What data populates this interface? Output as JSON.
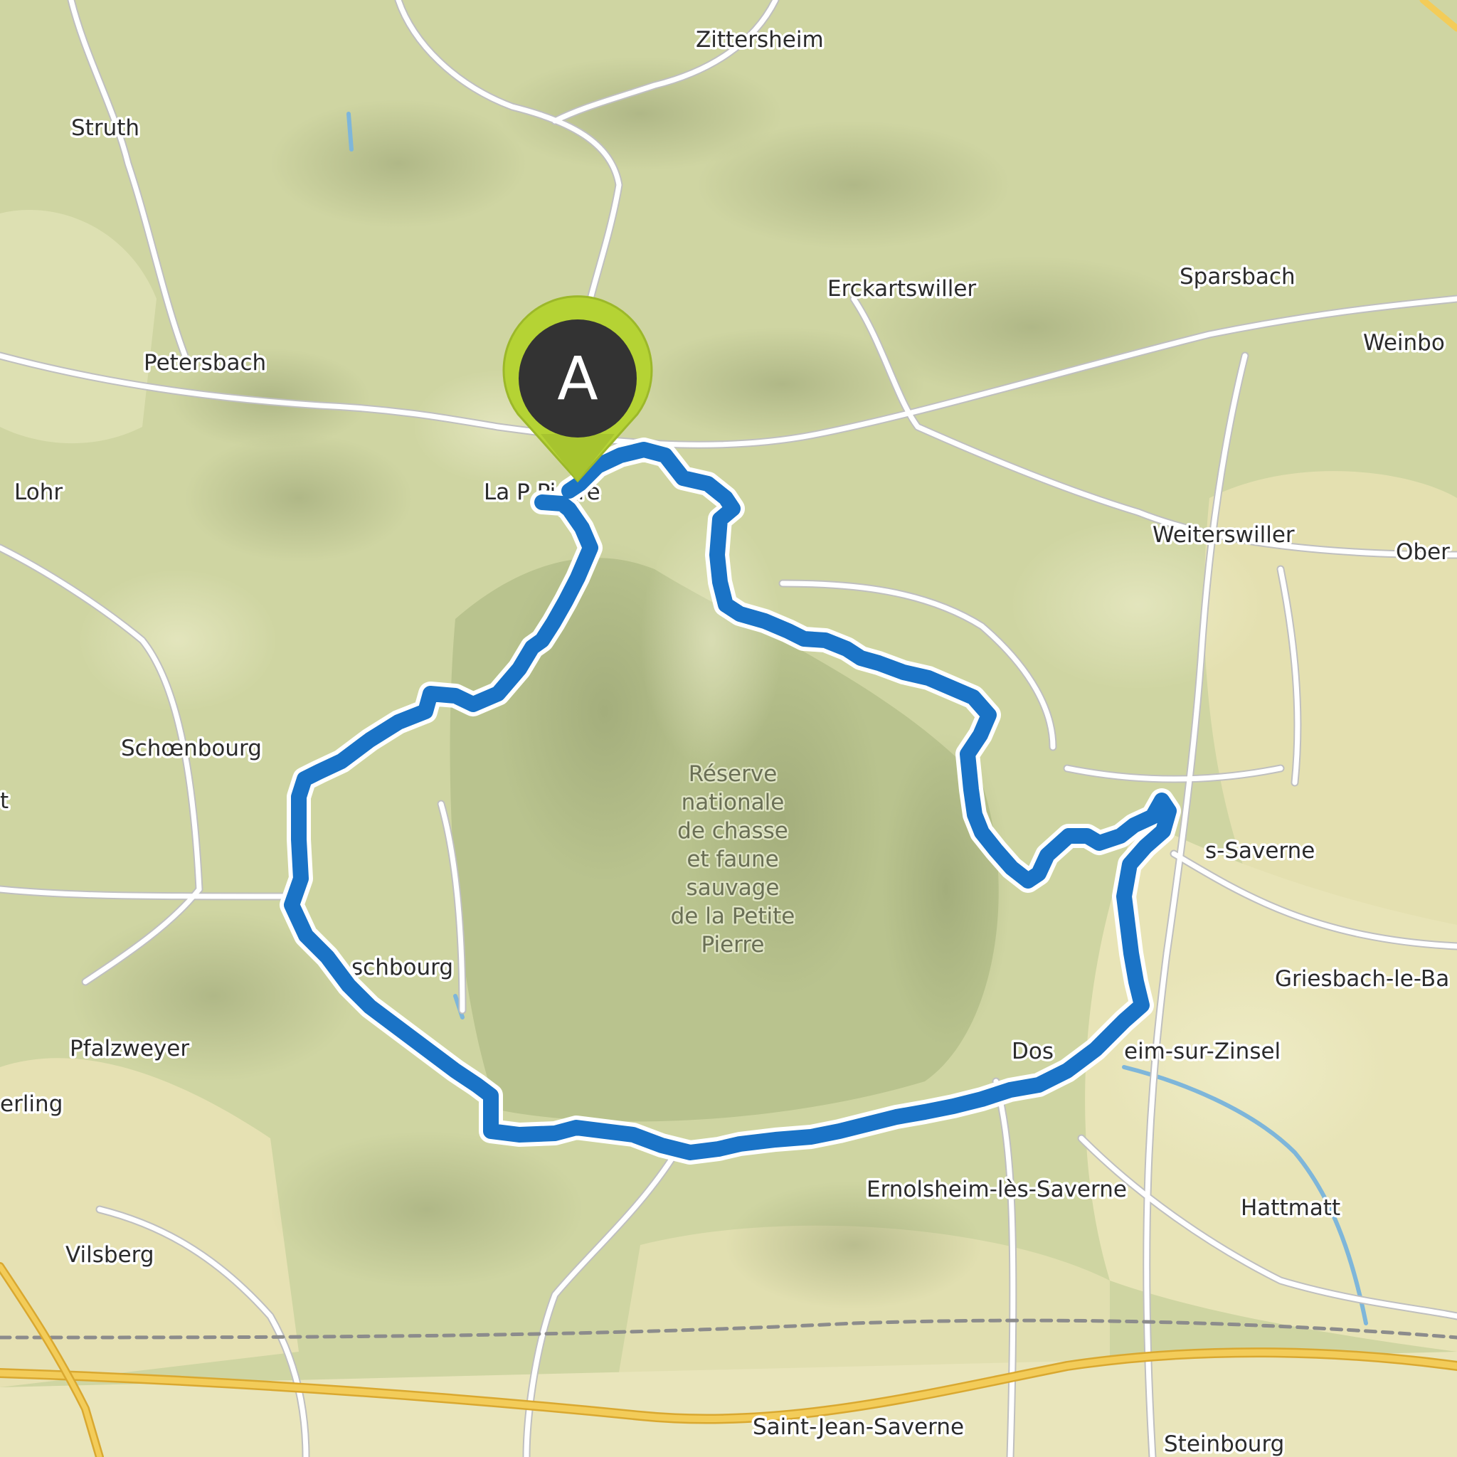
{
  "map": {
    "places": [
      {
        "id": "zittersheim",
        "label": "Zittersheim"
      },
      {
        "id": "struth",
        "label": "Struth"
      },
      {
        "id": "erckartswiller",
        "label": "Erckartswiller"
      },
      {
        "id": "sparsbach",
        "label": "Sparsbach"
      },
      {
        "id": "petersbach",
        "label": "Petersbach"
      },
      {
        "id": "weinbo",
        "label": "Weinbo"
      },
      {
        "id": "lohr",
        "label": "Lohr"
      },
      {
        "id": "la-petite-pierre",
        "label": "La P        Pierre"
      },
      {
        "id": "weiterswiller",
        "label": "Weiterswiller"
      },
      {
        "id": "ober",
        "label": "Ober"
      },
      {
        "id": "schoenbourg",
        "label": "Schœnbourg"
      },
      {
        "id": "t",
        "label": "t"
      },
      {
        "id": "s-saverne",
        "label": "s-Saverne"
      },
      {
        "id": "schbourg",
        "label": "schbourg"
      },
      {
        "id": "griesbach",
        "label": "Griesbach-le-Ba"
      },
      {
        "id": "pfalzweyer",
        "label": "Pfalzweyer"
      },
      {
        "id": "dos",
        "label": "Dos"
      },
      {
        "id": "eim-sur-zinsel",
        "label": "eim-sur-Zinsel"
      },
      {
        "id": "erling",
        "label": "erling"
      },
      {
        "id": "ernolsheim",
        "label": "Ernolsheim-lès-Saverne"
      },
      {
        "id": "hattmatt",
        "label": "Hattmatt"
      },
      {
        "id": "vilsberg",
        "label": "Vilsberg"
      },
      {
        "id": "saint-jean-saverne",
        "label": "Saint-Jean-Saverne"
      },
      {
        "id": "steinbourg",
        "label": "Steinbourg"
      }
    ],
    "reserve_label": [
      "Réserve",
      "nationale",
      "de chasse",
      "et faune",
      "sauvage",
      "de la Petite",
      "Pierre"
    ],
    "start_marker": {
      "letter": "A"
    },
    "colors": {
      "route": "#1a73c6",
      "route_outline": "#ffffff",
      "marker_ring": "#b5d334",
      "marker_fill": "#333333",
      "forest": "#c7d09a",
      "open_land": "#e6e2b4",
      "road": "#ffffff",
      "highway": "#f0c040",
      "water": "#7eb6da"
    }
  }
}
